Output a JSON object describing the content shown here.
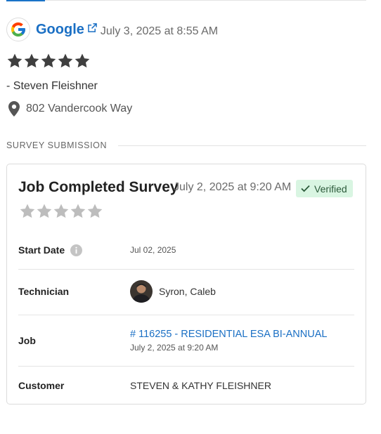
{
  "review": {
    "source": "Google",
    "date": "July 3, 2025 at 8:55 AM",
    "rating": 5,
    "reviewer": "- Steven Fleishner",
    "location": "802 Vandercook Way"
  },
  "section": {
    "label": "SURVEY SUBMISSION"
  },
  "survey": {
    "title": "Job Completed Survey",
    "date": "July 2, 2025 at 9:20 AM",
    "badge": "Verified",
    "rating": 0,
    "fields": {
      "start_date": {
        "label": "Start Date",
        "value": "Jul 02, 2025"
      },
      "technician": {
        "label": "Technician",
        "value": "Syron, Caleb"
      },
      "job": {
        "label": "Job",
        "link": "# 116255 - RESIDENTIAL ESA BI-ANNUAL",
        "sub": "July 2, 2025 at 9:20 AM"
      },
      "customer": {
        "label": "Customer",
        "value": "STEVEN & KATHY FLEISHNER"
      }
    }
  },
  "colors": {
    "link": "#1a6fc4",
    "star_filled": "#3f3f3f",
    "star_empty": "#bdbdbd",
    "verified_bg": "#d9f5e2"
  },
  "icons": [
    "google-logo-icon",
    "external-link-icon",
    "star-icon",
    "map-pin-icon",
    "check-icon",
    "info-icon"
  ]
}
